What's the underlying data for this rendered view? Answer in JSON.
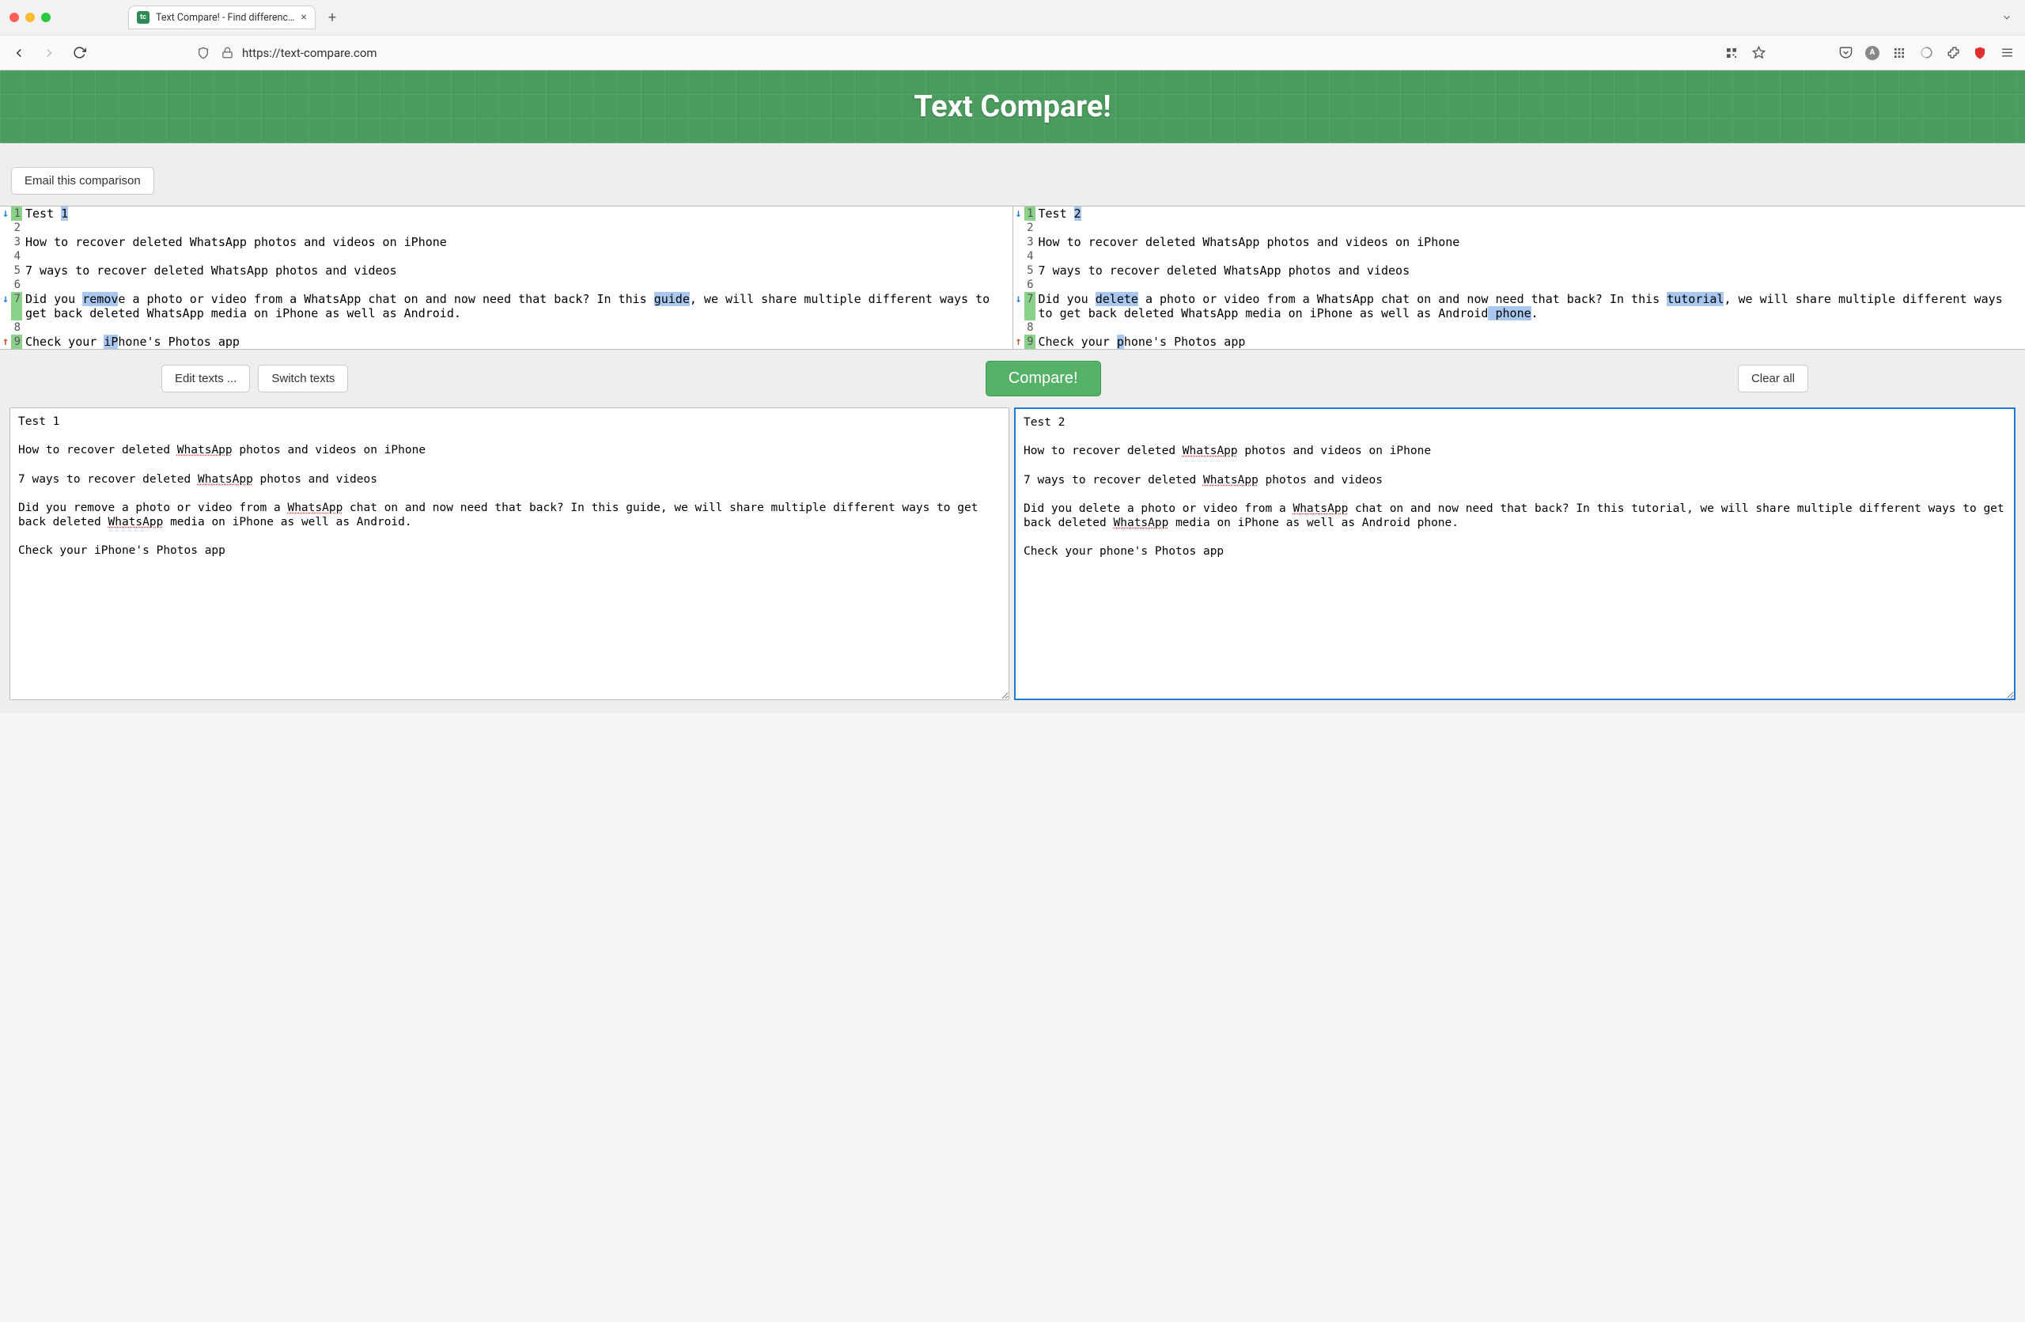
{
  "browser": {
    "tab_title": "Text Compare! - Find differenc…",
    "url": "https://text-compare.com"
  },
  "page": {
    "title": "Text Compare!",
    "email_button": "Email this comparison",
    "buttons": {
      "edit_texts": "Edit texts ...",
      "switch_texts": "Switch texts",
      "compare": "Compare!",
      "clear_all": "Clear all"
    }
  },
  "diff": {
    "left": {
      "rows": [
        {
          "marker": "down",
          "num": "1",
          "hl": true,
          "segments": [
            {
              "t": "Test "
            },
            {
              "t": "1",
              "hl": true
            }
          ]
        },
        {
          "marker": "",
          "num": "2",
          "segments": [
            {
              "t": ""
            }
          ]
        },
        {
          "marker": "",
          "num": "3",
          "segments": [
            {
              "t": "How to recover deleted WhatsApp photos and videos on iPhone"
            }
          ]
        },
        {
          "marker": "",
          "num": "4",
          "segments": [
            {
              "t": ""
            }
          ]
        },
        {
          "marker": "",
          "num": "5",
          "segments": [
            {
              "t": "7 ways to recover deleted WhatsApp photos and videos"
            }
          ]
        },
        {
          "marker": "",
          "num": "6",
          "segments": [
            {
              "t": ""
            }
          ]
        },
        {
          "marker": "down",
          "num": "7",
          "hl": true,
          "segments": [
            {
              "t": "Did you "
            },
            {
              "t": "remov",
              "hl": true
            },
            {
              "t": "e a photo or video from a WhatsApp chat on and now need that back? In this "
            },
            {
              "t": "guide",
              "hl": true
            },
            {
              "t": ", we will share multiple different ways to get back deleted WhatsApp media on iPhone as well as Android."
            }
          ]
        },
        {
          "marker": "",
          "num": "8",
          "segments": [
            {
              "t": ""
            }
          ]
        },
        {
          "marker": "up",
          "num": "9",
          "hl": true,
          "segments": [
            {
              "t": "Check your "
            },
            {
              "t": "iP",
              "hl": true
            },
            {
              "t": "hone's Photos app"
            }
          ]
        }
      ]
    },
    "right": {
      "rows": [
        {
          "marker": "down",
          "num": "1",
          "hl": true,
          "segments": [
            {
              "t": "Test "
            },
            {
              "t": "2",
              "hl": true
            }
          ]
        },
        {
          "marker": "",
          "num": "2",
          "segments": [
            {
              "t": ""
            }
          ]
        },
        {
          "marker": "",
          "num": "3",
          "segments": [
            {
              "t": "How to recover deleted WhatsApp photos and videos on iPhone"
            }
          ]
        },
        {
          "marker": "",
          "num": "4",
          "segments": [
            {
              "t": ""
            }
          ]
        },
        {
          "marker": "",
          "num": "5",
          "segments": [
            {
              "t": "7 ways to recover deleted WhatsApp photos and videos"
            }
          ]
        },
        {
          "marker": "",
          "num": "6",
          "segments": [
            {
              "t": ""
            }
          ]
        },
        {
          "marker": "down",
          "num": "7",
          "hl": true,
          "segments": [
            {
              "t": "Did you "
            },
            {
              "t": "delete",
              "hl": true
            },
            {
              "t": " a photo or video from a WhatsApp chat on and now need that back? In this "
            },
            {
              "t": "tutorial",
              "hl": true
            },
            {
              "t": ", we will share multiple different ways to get back deleted WhatsApp media on iPhone as well as Android"
            },
            {
              "t": " phone",
              "hl": true
            },
            {
              "t": "."
            }
          ]
        },
        {
          "marker": "",
          "num": "8",
          "segments": [
            {
              "t": ""
            }
          ]
        },
        {
          "marker": "up",
          "num": "9",
          "hl": true,
          "segments": [
            {
              "t": "Check your "
            },
            {
              "t": "p",
              "hl": true
            },
            {
              "t": "hone's Photos app"
            }
          ]
        }
      ]
    }
  },
  "textareas": {
    "left": "Test 1\n\nHow to recover deleted WhatsApp photos and videos on iPhone\n\n7 ways to recover deleted WhatsApp photos and videos\n\nDid you remove a photo or video from a WhatsApp chat on and now need that back? In this guide, we will share multiple different ways to get back deleted WhatsApp media on iPhone as well as Android.\n\nCheck your iPhone's Photos app",
    "right": "Test 2\n\nHow to recover deleted WhatsApp photos and videos on iPhone\n\n7 ways to recover deleted WhatsApp photos and videos\n\nDid you delete a photo or video from a WhatsApp chat on and now need that back? In this tutorial, we will share multiple different ways to get back deleted WhatsApp media on iPhone as well as Android phone.\n\nCheck your phone's Photos app"
  },
  "spellcheck_words": [
    "WhatsApp"
  ]
}
